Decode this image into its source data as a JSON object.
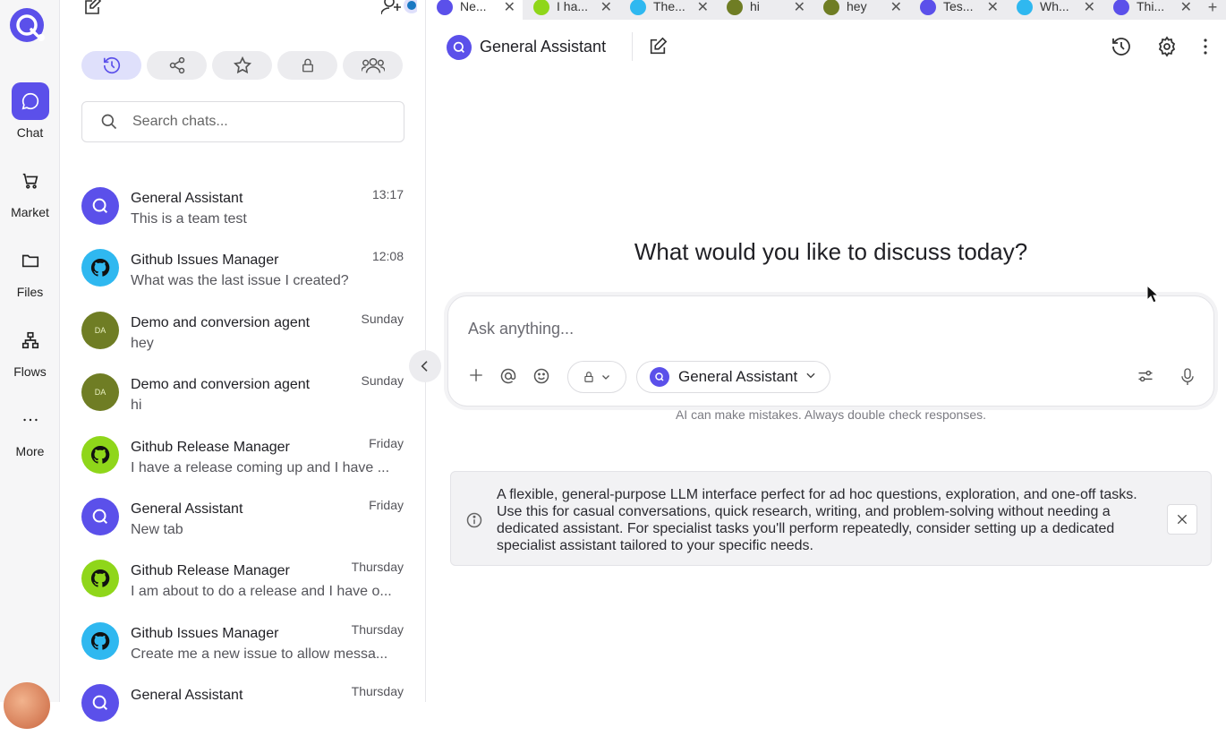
{
  "rail": {
    "items": [
      {
        "label": "Chat",
        "icon": "chat-bubble-icon",
        "active": true
      },
      {
        "label": "Market",
        "icon": "cart-icon"
      },
      {
        "label": "Files",
        "icon": "folder-icon"
      },
      {
        "label": "Flows",
        "icon": "flow-icon"
      },
      {
        "label": "More",
        "icon": "more-dots-icon"
      }
    ]
  },
  "sidebar": {
    "search_placeholder": "Search chats...",
    "filters": [
      "history-icon",
      "share-icon",
      "star-icon",
      "lock-icon",
      "team-icon"
    ],
    "chats": [
      {
        "title": "General Assistant",
        "subtitle": "This is a team test",
        "time": "13:17",
        "avatar": "ga"
      },
      {
        "title": "Github Issues Manager",
        "subtitle": "What was the last issue I created?",
        "time": "12:08",
        "avatar": "gh"
      },
      {
        "title": "Demo and conversion agent",
        "subtitle": "hey",
        "time": "Sunday",
        "avatar": "da",
        "initials": "DA"
      },
      {
        "title": "Demo and conversion agent",
        "subtitle": "hi",
        "time": "Sunday",
        "avatar": "da",
        "initials": "DA"
      },
      {
        "title": "Github Release Manager",
        "subtitle": "I have a release coming up and I have ...",
        "time": "Friday",
        "avatar": "grm"
      },
      {
        "title": "General Assistant",
        "subtitle": "New tab",
        "time": "Friday",
        "avatar": "ga"
      },
      {
        "title": "Github Release Manager",
        "subtitle": "I am about to do a release and I have o...",
        "time": "Thursday",
        "avatar": "grm"
      },
      {
        "title": "Github Issues Manager",
        "subtitle": "Create me a new issue to allow messa...",
        "time": "Thursday",
        "avatar": "gh"
      },
      {
        "title": "General Assistant",
        "subtitle": "",
        "time": "Thursday",
        "avatar": "ga"
      }
    ]
  },
  "tabs": [
    {
      "label": "Ne...",
      "avatar": "ga",
      "active": true
    },
    {
      "label": "I ha...",
      "avatar": "grm"
    },
    {
      "label": "The...",
      "avatar": "gh"
    },
    {
      "label": "hi",
      "avatar": "da"
    },
    {
      "label": "hey",
      "avatar": "da"
    },
    {
      "label": "Tes...",
      "avatar": "ga"
    },
    {
      "label": "Wh...",
      "avatar": "gh"
    },
    {
      "label": "Thi...",
      "avatar": "ga"
    }
  ],
  "header": {
    "title": "General Assistant"
  },
  "main": {
    "headline": "What would you like to discuss today?",
    "composer_placeholder": "Ask anything...",
    "agent_label": "General Assistant",
    "disclaimer": "AI can make mistakes. Always double check responses.",
    "info_text": "A flexible, general-purpose LLM interface perfect for ad hoc questions, exploration, and one-off tasks. Use this for casual conversations, quick research, writing, and problem-solving without needing a dedicated assistant. For specialist tasks you'll perform repeatedly, consider setting up a dedicated specialist assistant tailored to your specific needs."
  },
  "colors": {
    "accent": "#5b50ea",
    "github_blue": "#2fb8f0",
    "github_green": "#8fd61a",
    "demo_olive": "#6f7d24"
  }
}
